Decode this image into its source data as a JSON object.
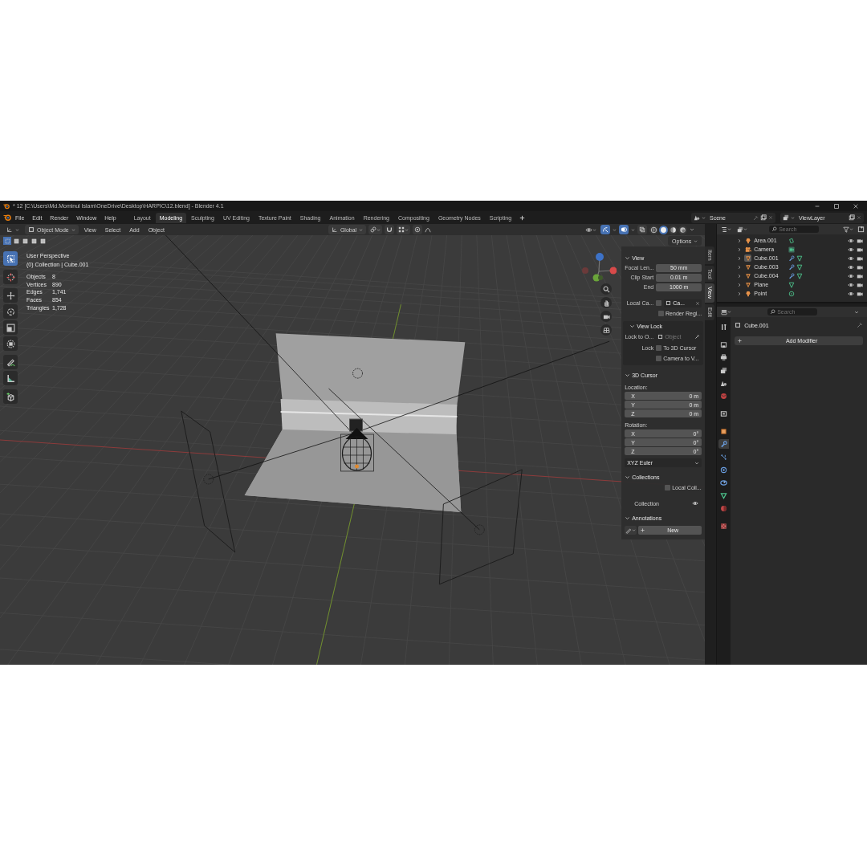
{
  "title_bar": {
    "title": "* 12 [C:\\Users\\Md.Mominul Islam\\OneDrive\\Desktop\\HARPIC\\12.blend] - Blender 4.1"
  },
  "menu_bar": {
    "menus": [
      "File",
      "Edit",
      "Render",
      "Window",
      "Help"
    ],
    "workspaces": [
      {
        "label": "Layout",
        "selected": false
      },
      {
        "label": "Modeling",
        "selected": true
      },
      {
        "label": "Sculpting",
        "selected": false
      },
      {
        "label": "UV Editing",
        "selected": false
      },
      {
        "label": "Texture Paint",
        "selected": false
      },
      {
        "label": "Shading",
        "selected": false
      },
      {
        "label": "Animation",
        "selected": false
      },
      {
        "label": "Rendering",
        "selected": false
      },
      {
        "label": "Compositing",
        "selected": false
      },
      {
        "label": "Geometry Nodes",
        "selected": false
      },
      {
        "label": "Scripting",
        "selected": false
      }
    ],
    "scene": "Scene",
    "view_layer": "ViewLayer"
  },
  "viewport_header": {
    "mode": "Object Mode",
    "menus": [
      "View",
      "Select",
      "Add",
      "Object"
    ],
    "orientation": "Global",
    "options": "Options",
    "select_modes": [
      {
        "selected": true
      },
      {
        "selected": false
      },
      {
        "selected": false
      },
      {
        "selected": false
      },
      {
        "selected": false
      }
    ],
    "toggles": {
      "gizmos": true,
      "overlays": true,
      "xray": false
    },
    "shading": [
      {
        "kind": "wireframe",
        "selected": false
      },
      {
        "kind": "solid",
        "selected": true
      },
      {
        "kind": "material",
        "selected": false
      },
      {
        "kind": "rendered",
        "selected": false
      }
    ]
  },
  "viewport_overlay": {
    "view_name": "User Perspective",
    "context": "(0) Collection | Cube.001",
    "stats": [
      {
        "label": "Objects",
        "value": "8"
      },
      {
        "label": "Vertices",
        "value": "890"
      },
      {
        "label": "Edges",
        "value": "1,741"
      },
      {
        "label": "Faces",
        "value": "854"
      },
      {
        "label": "Triangles",
        "value": "1,728"
      }
    ]
  },
  "tools": [
    {
      "kind": "select",
      "selected": true
    },
    {
      "kind": "cursor",
      "selected": false
    },
    {
      "kind": "move",
      "selected": false
    },
    {
      "kind": "rotate",
      "selected": false
    },
    {
      "kind": "scale",
      "selected": false
    },
    {
      "kind": "transform",
      "selected": false
    },
    {
      "kind": "annotate",
      "selected": false
    },
    {
      "kind": "measure",
      "selected": false
    },
    {
      "kind": "add_cube",
      "selected": false
    }
  ],
  "sidebar": {
    "tabs": [
      {
        "label": "Item",
        "selected": false
      },
      {
        "label": "Tool",
        "selected": false
      },
      {
        "label": "View",
        "selected": true
      },
      {
        "label": "Edit",
        "selected": false
      }
    ],
    "panels": [
      {
        "title": "View",
        "expanded": true,
        "rows": [
          {
            "kind": "number",
            "label": "Focal Len...",
            "value": "50 mm"
          },
          {
            "kind": "number",
            "label": "Clip Start",
            "value": "0.01 m"
          },
          {
            "kind": "number",
            "label": "End",
            "value": "1000 m"
          },
          {
            "kind": "object",
            "label": "Local Ca...",
            "checked": false,
            "value": "Ca..."
          },
          {
            "kind": "check",
            "text": "Render Regi...",
            "checked": false
          },
          {
            "kind": "subpanel",
            "title": "View Lock",
            "expanded": true,
            "rows": [
              {
                "kind": "object",
                "label": "Lock to O...",
                "placeholder": "Object"
              },
              {
                "kind": "check",
                "label": "Lock",
                "text": "To 3D Cursor",
                "checked": false
              },
              {
                "kind": "check",
                "text": "Camera to V...",
                "checked": false
              }
            ]
          }
        ]
      },
      {
        "title": "3D Cursor",
        "expanded": true,
        "rows": [
          {
            "kind": "caption",
            "text": "Location:"
          },
          {
            "kind": "vector",
            "items": [
              {
                "axis": "X",
                "value": "0 m"
              },
              {
                "axis": "Y",
                "value": "0 m"
              },
              {
                "axis": "Z",
                "value": "0 m"
              }
            ]
          },
          {
            "kind": "caption",
            "text": "Rotation:"
          },
          {
            "kind": "vector",
            "items": [
              {
                "axis": "X",
                "value": "0°"
              },
              {
                "axis": "Y",
                "value": "0°"
              },
              {
                "axis": "Z",
                "value": "0°"
              }
            ]
          },
          {
            "kind": "dropdown",
            "value": "XYZ Euler"
          }
        ]
      },
      {
        "title": "Collections",
        "expanded": true,
        "rows": [
          {
            "kind": "check",
            "text": "Local Coll...",
            "checked": false
          },
          {
            "kind": "collection",
            "label": "Collection",
            "visible": true
          }
        ]
      },
      {
        "title": "Annotations",
        "expanded": true,
        "rows": [
          {
            "kind": "button",
            "value": "New"
          }
        ]
      }
    ]
  },
  "outliner": {
    "search_placeholder": "Search",
    "items": [
      {
        "name": "Area.001",
        "kind": "area_light",
        "modifiers": false,
        "selected": false
      },
      {
        "name": "Camera",
        "kind": "camera",
        "modifiers": false,
        "selected": false
      },
      {
        "name": "Cube.001",
        "kind": "mesh",
        "modifiers": true,
        "selected": true
      },
      {
        "name": "Cube.003",
        "kind": "mesh",
        "modifiers": true,
        "selected": false
      },
      {
        "name": "Cube.004",
        "kind": "mesh",
        "modifiers": true,
        "selected": false
      },
      {
        "name": "Plane",
        "kind": "mesh",
        "modifiers": false,
        "selected": false
      },
      {
        "name": "Point",
        "kind": "point_light",
        "modifiers": false,
        "selected": false
      }
    ]
  },
  "properties": {
    "search_placeholder": "Search",
    "object_name": "Cube.001",
    "add_modifier": "Add Modifier",
    "tabs": [
      {
        "kind": "tool",
        "selected": false
      },
      {
        "kind": "render",
        "selected": false
      },
      {
        "kind": "output",
        "selected": false
      },
      {
        "kind": "view_layer",
        "selected": false
      },
      {
        "kind": "scene",
        "selected": false
      },
      {
        "kind": "world",
        "selected": false
      },
      {
        "kind": "collection",
        "selected": false
      },
      {
        "kind": "object",
        "selected": false
      },
      {
        "kind": "modifiers",
        "selected": true
      },
      {
        "kind": "particles",
        "selected": false
      },
      {
        "kind": "physics",
        "selected": false
      },
      {
        "kind": "constraints",
        "selected": false
      },
      {
        "kind": "data",
        "selected": false
      },
      {
        "kind": "material",
        "selected": false
      },
      {
        "kind": "texture",
        "selected": false
      }
    ]
  }
}
